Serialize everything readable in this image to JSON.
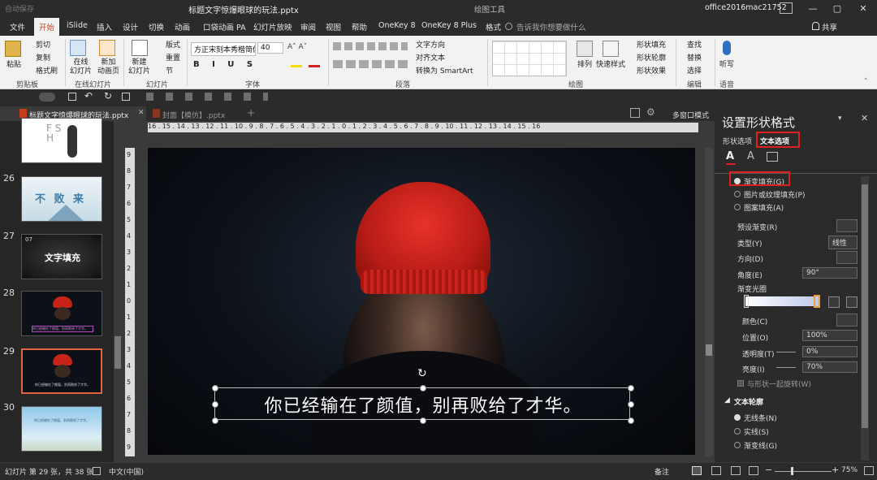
{
  "window": {
    "title": "标题文字惊爆眼球的玩法.pptx",
    "tools_context": "绘图工具",
    "user": "office2016mac21752",
    "controls": [
      "—",
      "▢",
      "✕"
    ],
    "autosave": "自动保存"
  },
  "tabs": [
    "文件",
    "开始",
    "iSlide",
    "插入",
    "设计",
    "切换",
    "动画",
    "口袋动画 PA",
    "幻灯片放映",
    "审阅",
    "视图",
    "帮助",
    "OneKey 8",
    "OneKey 8 Plus",
    "格式"
  ],
  "active_tab": "开始",
  "tell_me": "告诉我你想要做什么",
  "share": "共享",
  "ribbon": {
    "clipboard": {
      "paste": "粘贴",
      "cut": "剪切",
      "copy": "复制",
      "format_painter": "格式刷",
      "label": "剪贴板"
    },
    "online_slides": {
      "online": "在线\n幻灯片",
      "new_anim": "新加\n动画页",
      "label": "在线幻灯片"
    },
    "slides": {
      "new_slide": "新建\n幻灯片",
      "layout": "版式",
      "reset": "重置",
      "section": "节",
      "label": "幻灯片"
    },
    "font": {
      "name": "方正宋刻本秀楷简体",
      "size": "40",
      "label": "字体"
    },
    "paragraph": {
      "text_direction": "文字方向",
      "align_text": "对齐文本",
      "convert_smartart": "转换为 SmartArt",
      "label": "段落"
    },
    "drawing": {
      "arrange": "排列",
      "quick_styles": "快速样式",
      "shape_fill": "形状填充",
      "shape_outline": "形状轮廓",
      "shape_effects": "形状效果",
      "label": "绘图"
    },
    "editing": {
      "find": "查找",
      "replace": "替换",
      "select": "选择",
      "label": "编辑"
    },
    "voice": {
      "dictate": "听写",
      "label": "语音"
    }
  },
  "doc_tabs": [
    {
      "name": "标题文字惊爆眼球的玩法.pptx",
      "close": "✕"
    },
    {
      "name": "封面【模仿】.pptx"
    }
  ],
  "add_tab": "+",
  "multi_window": "多窗口模式",
  "ruler_h": "16 . 15 . 14 . 13 . 12 . 11 . 10 . 9 . 8 . 7 . 6 . 5 . 4 . 3 . 2 . 1 . 0 . 1 . 2 . 3 . 4 . 5 . 6 . 7 . 8 . 9 . 10 . 11 . 12 . 13 . 14 . 15 . 16",
  "ruler_v": [
    "9",
    "8",
    "7",
    "6",
    "5",
    "4",
    "3",
    "2",
    "1",
    "0",
    "1",
    "2",
    "3",
    "4",
    "5",
    "6",
    "7",
    "8",
    "9"
  ],
  "thumbnails": [
    {
      "num": "26",
      "text": "不 败 来"
    },
    {
      "num": "27",
      "text": "文字填充",
      "badge": "07"
    },
    {
      "num": "28",
      "text": "你已经输在了颜值，别再败给了才华。"
    },
    {
      "num": "29",
      "text": "你已经输在了颜值，别再败给了才华。"
    },
    {
      "num": "30",
      "text": "你已经输在了颜值，别再败给了才华。"
    }
  ],
  "top_thumb_text": "F S\nH",
  "slide": {
    "caption": "你已经输在了颜值，别再败给了才华。"
  },
  "format_pane": {
    "title": "设置形状格式",
    "tab_shape": "形状选项",
    "tab_text": "文本选项",
    "fill_options": [
      {
        "label": "渐变填充(G)",
        "checked": true
      },
      {
        "label": "图片或纹理填充(P)",
        "checked": false
      },
      {
        "label": "图案填充(A)",
        "checked": false
      }
    ],
    "preset_gradient": "预设渐变(R)",
    "type_label": "类型(Y)",
    "type_value": "线性",
    "direction_label": "方向(D)",
    "angle_label": "角度(E)",
    "angle_value": "90°",
    "gradient_stops": "渐变光圈",
    "color_label": "颜色(C)",
    "position_label": "位置(O)",
    "position_value": "100%",
    "transparency_label": "透明度(T)",
    "transparency_value": "0%",
    "brightness_label": "亮度(I)",
    "brightness_value": "70%",
    "rotate_with_shape": "与形状一起旋转(W)",
    "outline_section": "文本轮廓",
    "outline_options": [
      {
        "label": "无线条(N)",
        "checked": true
      },
      {
        "label": "实线(S)",
        "checked": false
      },
      {
        "label": "渐变线(G)",
        "checked": false
      }
    ]
  },
  "status": {
    "slide_info": "幻灯片 第 29 张，共 38 张",
    "language": "中文(中国)",
    "notes": "备注",
    "zoom": "75%"
  }
}
